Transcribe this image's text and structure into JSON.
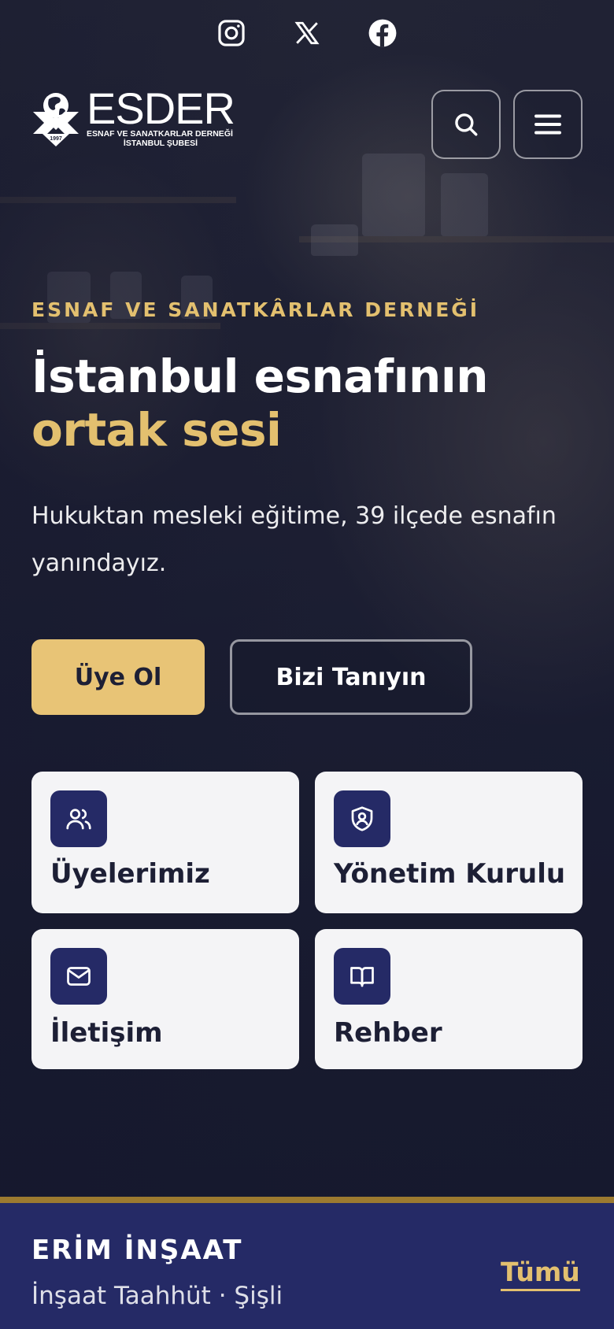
{
  "social": {
    "items": [
      {
        "icon": "instagram-icon"
      },
      {
        "icon": "x-icon"
      },
      {
        "icon": "facebook-icon"
      }
    ]
  },
  "logo": {
    "wordmark": "ESDER",
    "line1": "ESNAF VE SANATKARLAR DERNEĞİ",
    "line2": "İSTANBUL ŞUBESİ",
    "year": "1997"
  },
  "header": {
    "search_icon": "search-icon",
    "menu_icon": "menu-icon"
  },
  "hero": {
    "kicker": "ESNAF VE SANATKÂRLAR DERNEĞİ",
    "title_line1": "İstanbul esnafının",
    "title_line2": "ortak sesi",
    "lead": "Hukuktan mesleki eğitime, 39 ilçede esnafın yanındayız.",
    "primary_button": "Üye Ol",
    "secondary_button": "Bizi Tanıyın"
  },
  "quick_links": [
    {
      "label": "Üyelerimiz",
      "icon": "users-icon"
    },
    {
      "label": "Yönetim Kurulu",
      "icon": "shield-user-icon"
    },
    {
      "label": "İletişim",
      "icon": "mail-icon"
    },
    {
      "label": "Rehber",
      "icon": "book-icon"
    }
  ],
  "ticker": {
    "name": "ERİM İNŞAAT",
    "detail": "İnşaat Taahhüt · Şişli",
    "all_link": "Tümü"
  },
  "colors": {
    "gold": "#e3c06f",
    "primary_button": "#e8c476",
    "navy": "#252a66",
    "card_bg": "#f4f4f6"
  }
}
